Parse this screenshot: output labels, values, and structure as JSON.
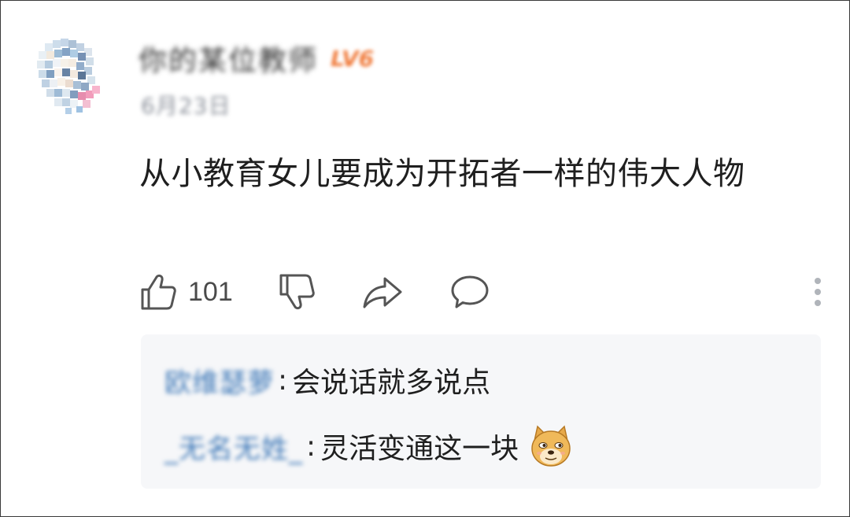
{
  "comment": {
    "author": {
      "name": "你的某位教师",
      "level_badge": "LV6",
      "avatar_icon": "anime-avatar-icon"
    },
    "date": "6月23日",
    "text": "从小教育女儿要成为开拓者一样的伟大人物",
    "actions": {
      "like_icon": "thumbs-up-icon",
      "like_count": "101",
      "dislike_icon": "thumbs-down-icon",
      "share_icon": "share-icon",
      "reply_icon": "comment-bubble-icon",
      "more_icon": "more-vertical-icon"
    }
  },
  "replies": [
    {
      "name": "欧维瑟萝",
      "text": "会说话就多说点",
      "emoji": ""
    },
    {
      "name": "_无名无姓_",
      "text": "灵活变通这一块",
      "emoji": "doge-emoji-icon"
    }
  ],
  "colors": {
    "reply_name": "#3f79b8",
    "level_badge": "#f07a3a",
    "reply_bg": "#f6f7f9",
    "text": "#1f1f1f",
    "muted": "#8a8f99"
  }
}
